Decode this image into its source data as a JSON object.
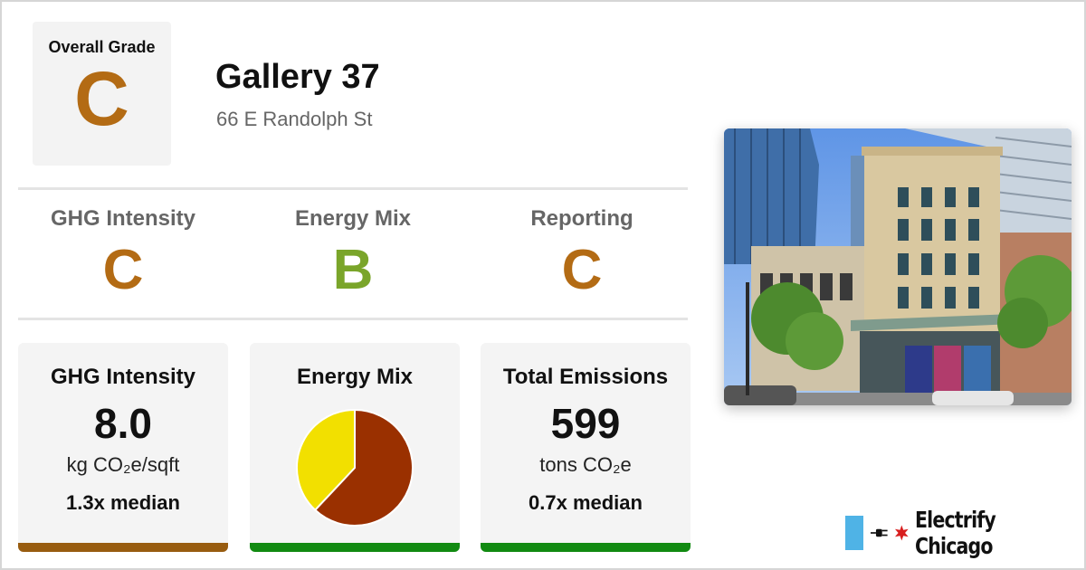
{
  "overall": {
    "label": "Overall Grade",
    "grade": "C",
    "grade_color": "#b36b14"
  },
  "building": {
    "name": "Gallery 37",
    "address": "66 E Randolph St"
  },
  "grades": [
    {
      "label": "GHG Intensity",
      "value": "C",
      "color": "#b36b14"
    },
    {
      "label": "Energy Mix",
      "value": "B",
      "color": "#7aa52a"
    },
    {
      "label": "Reporting",
      "value": "C",
      "color": "#b36b14"
    }
  ],
  "cards": {
    "ghg": {
      "title": "GHG Intensity",
      "value": "8.0",
      "unit": "kg CO₂e/sqft",
      "median": "1.3x median",
      "bar_color": "#985c10"
    },
    "mix": {
      "title": "Energy Mix",
      "bar_color": "#118a11"
    },
    "emissions": {
      "title": "Total Emissions",
      "value": "599",
      "unit": "tons CO₂e",
      "median": "0.7x median",
      "bar_color": "#118a11"
    }
  },
  "chart_data": {
    "type": "pie",
    "slices": [
      {
        "value": 62,
        "color": "#9a3000"
      },
      {
        "value": 38,
        "color": "#f2e000"
      }
    ]
  },
  "brand": {
    "name": "Electrify Chicago",
    "flag_color": "#4fb3e6",
    "star_color": "#d81e1e"
  }
}
